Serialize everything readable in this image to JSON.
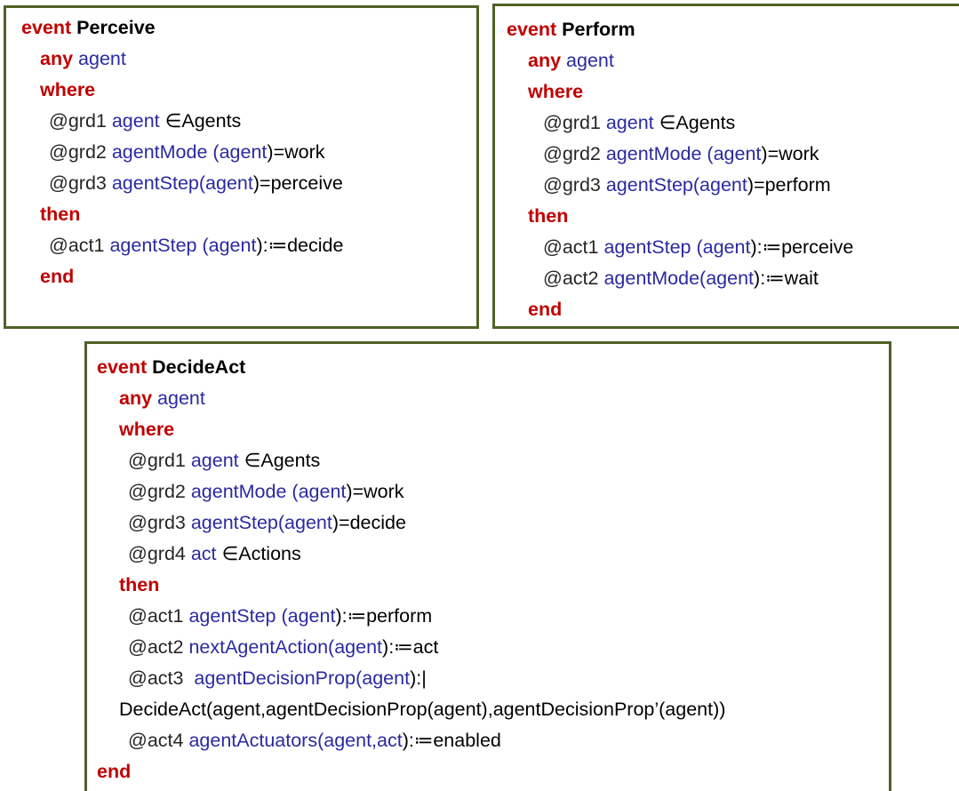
{
  "keywords": {
    "event": "event",
    "any": "any",
    "where": "where",
    "then": "then",
    "end": "end"
  },
  "events": {
    "perceive": {
      "name": "Perceive",
      "param": "agent",
      "grd1": {
        "label": "@grd1",
        "var": "agent",
        "rest": "∈Agents"
      },
      "grd2": {
        "label": "@grd2",
        "fn": "agentMode",
        "open": "(",
        "arg": "agent",
        "rest": ")=work"
      },
      "grd3": {
        "label": "@grd3",
        "fn": "agentStep",
        "open": "(",
        "arg": "agent",
        "rest": ")=perceive"
      },
      "act1": {
        "label": "@act1",
        "fn": "agentStep",
        "open": "(",
        "arg": "agent",
        "rest": "):≔decide"
      }
    },
    "perform": {
      "name": "Perform",
      "param": "agent",
      "grd1": {
        "label": "@grd1",
        "var": "agent",
        "rest": "∈Agents"
      },
      "grd2": {
        "label": "@grd2",
        "fn": "agentMode",
        "open": "(",
        "arg": "agent",
        "rest": ")=work"
      },
      "grd3": {
        "label": "@grd3",
        "fn": "agentStep",
        "open": "(",
        "arg": "agent",
        "rest": ")=perform"
      },
      "act1": {
        "label": "@act1",
        "fn": "agentStep",
        "open": "(",
        "arg": "agent",
        "rest": "):≔perceive"
      },
      "act2": {
        "label": "@act2",
        "fn": "agentMode",
        "open": "(",
        "arg": "agent",
        "rest": "):≔wait"
      }
    },
    "decideact": {
      "name": "DecideAct",
      "param": "agent",
      "grd1": {
        "label": "@grd1",
        "var": "agent",
        "rest": "∈Agents"
      },
      "grd2": {
        "label": "@grd2",
        "fn": "agentMode",
        "open": "(",
        "arg": "agent",
        "rest": ")=work"
      },
      "grd3": {
        "label": "@grd3",
        "fn": "agentStep",
        "open": "(",
        "arg": "agent",
        "rest": ")=decide"
      },
      "grd4": {
        "label": "@grd4",
        "var": "act",
        "rest": "∈Actions"
      },
      "act1": {
        "label": "@act1",
        "fn": "agentStep",
        "open": "(",
        "arg": "agent",
        "rest": "):≔perform"
      },
      "act2": {
        "label": "@act2",
        "fn": "nextAgentAction",
        "open": "(",
        "arg": "agent",
        "rest": "):≔act"
      },
      "act3": {
        "label": "@act3",
        "fn": "agentDecisionProp",
        "open": "(",
        "arg": "agent",
        "rest": "):|"
      },
      "act3_cont": "DecideAct(agent,agentDecisionProp(agent),agentDecisionProp’(agent))",
      "act4": {
        "label": "@act4",
        "fn": "agentActuators",
        "open": "(",
        "arg": "agent,act",
        "rest": "):≔enabled"
      }
    }
  },
  "colors": {
    "border": "#4f6228",
    "keyword": "#c00000",
    "identifier": "#2a2aa0",
    "text": "#000000"
  }
}
